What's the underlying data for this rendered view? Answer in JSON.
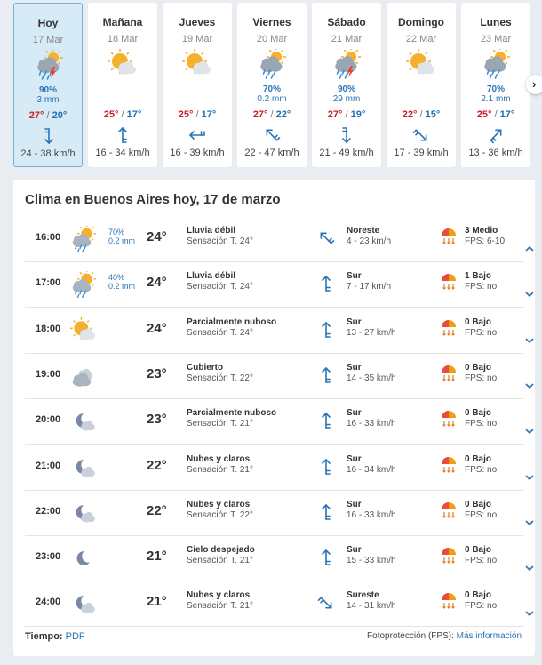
{
  "days": [
    {
      "name": "Hoy",
      "date": "17 Mar",
      "icon": "storm-rain-icon",
      "prob": "90%",
      "mm": "3 mm",
      "tmax": "27°",
      "tmin": "20°",
      "wind_icon": "wind-south-icon",
      "wind": "24 - 38 km/h",
      "active": true
    },
    {
      "name": "Mañana",
      "date": "18 Mar",
      "icon": "partly-cloudy-icon",
      "prob": "",
      "mm": "",
      "tmax": "25°",
      "tmin": "17°",
      "wind_icon": "wind-north-icon",
      "wind": "16 - 34 km/h",
      "active": false
    },
    {
      "name": "Jueves",
      "date": "19 Mar",
      "icon": "partly-cloudy-icon",
      "prob": "",
      "mm": "",
      "tmax": "25°",
      "tmin": "17°",
      "wind_icon": "wind-east-icon",
      "wind": "16 - 39 km/h",
      "active": false
    },
    {
      "name": "Viernes",
      "date": "20 Mar",
      "icon": "cloud-rain-icon",
      "prob": "70%",
      "mm": "0.2 mm",
      "tmax": "27°",
      "tmin": "22°",
      "wind_icon": "wind-northeast-icon",
      "wind": "22 - 47 km/h",
      "active": false
    },
    {
      "name": "Sábado",
      "date": "21 Mar",
      "icon": "storm-rain-icon",
      "prob": "90%",
      "mm": "29 mm",
      "tmax": "27°",
      "tmin": "19°",
      "wind_icon": "wind-south-icon",
      "wind": "21 - 49 km/h",
      "active": false
    },
    {
      "name": "Domingo",
      "date": "22 Mar",
      "icon": "partly-cloudy-icon",
      "prob": "",
      "mm": "",
      "tmax": "22°",
      "tmin": "15°",
      "wind_icon": "wind-northwest-icon",
      "wind": "17 - 39 km/h",
      "active": false
    },
    {
      "name": "Lunes",
      "date": "23 Mar",
      "icon": "cloud-rain-icon",
      "prob": "70%",
      "mm": "2.1 mm",
      "tmax": "25°",
      "tmin": "17°",
      "wind_icon": "wind-southwest-icon",
      "wind": "13 - 36 km/h",
      "active": false
    }
  ],
  "temp_sep": "/",
  "next_label": "›",
  "title": "Clima en Buenos Aires hoy, 17 de marzo",
  "hours": [
    {
      "hour": "16:00",
      "icon": "sun-cloud-rain-icon",
      "prob": "70%",
      "mm": "0.2 mm",
      "temp": "24°",
      "desc": "Lluvia débil",
      "feel": "Sensación T. 24°",
      "wind_icon": "wind-northeast-icon",
      "dir": "Noreste",
      "wind": "4 - 23 km/h",
      "uv": "3 Medio",
      "fps": "FPS: 6-10",
      "expanded": true
    },
    {
      "hour": "17:00",
      "icon": "sun-cloud-rain-icon",
      "prob": "40%",
      "mm": "0.2 mm",
      "temp": "24°",
      "desc": "Lluvia débil",
      "feel": "Sensación T. 24°",
      "wind_icon": "wind-north-icon",
      "dir": "Sur",
      "wind": "7 - 17 km/h",
      "uv": "1 Bajo",
      "fps": "FPS: no",
      "expanded": false
    },
    {
      "hour": "18:00",
      "icon": "partly-cloudy-icon",
      "prob": "",
      "mm": "",
      "temp": "24°",
      "desc": "Parcialmente nuboso",
      "feel": "Sensación T. 24°",
      "wind_icon": "wind-north-icon",
      "dir": "Sur",
      "wind": "13 - 27 km/h",
      "uv": "0 Bajo",
      "fps": "FPS: no",
      "expanded": false
    },
    {
      "hour": "19:00",
      "icon": "cloudy-icon",
      "prob": "",
      "mm": "",
      "temp": "23°",
      "desc": "Cubierto",
      "feel": "Sensación T. 22°",
      "wind_icon": "wind-north-icon",
      "dir": "Sur",
      "wind": "14 - 35 km/h",
      "uv": "0 Bajo",
      "fps": "FPS: no",
      "expanded": false
    },
    {
      "hour": "20:00",
      "icon": "moon-cloud-icon",
      "prob": "",
      "mm": "",
      "temp": "23°",
      "desc": "Parcialmente nuboso",
      "feel": "Sensación T. 21°",
      "wind_icon": "wind-north-icon",
      "dir": "Sur",
      "wind": "16 - 33 km/h",
      "uv": "0 Bajo",
      "fps": "FPS: no",
      "expanded": false
    },
    {
      "hour": "21:00",
      "icon": "moon-cloud-icon",
      "prob": "",
      "mm": "",
      "temp": "22°",
      "desc": "Nubes y claros",
      "feel": "Sensación T. 21°",
      "wind_icon": "wind-north-icon",
      "dir": "Sur",
      "wind": "16 - 34 km/h",
      "uv": "0 Bajo",
      "fps": "FPS: no",
      "expanded": false
    },
    {
      "hour": "22:00",
      "icon": "moon-cloud-icon",
      "prob": "",
      "mm": "",
      "temp": "22°",
      "desc": "Nubes y claros",
      "feel": "Sensación T. 22°",
      "wind_icon": "wind-north-icon",
      "dir": "Sur",
      "wind": "16 - 33 km/h",
      "uv": "0 Bajo",
      "fps": "FPS: no",
      "expanded": false
    },
    {
      "hour": "23:00",
      "icon": "moon-icon",
      "prob": "",
      "mm": "",
      "temp": "21°",
      "desc": "Cielo despejado",
      "feel": "Sensación T. 21°",
      "wind_icon": "wind-north-icon",
      "dir": "Sur",
      "wind": "15 - 33 km/h",
      "uv": "0 Bajo",
      "fps": "FPS: no",
      "expanded": false
    },
    {
      "hour": "24:00",
      "icon": "moon-cloud-icon",
      "prob": "",
      "mm": "",
      "temp": "21°",
      "desc": "Nubes y claros",
      "feel": "Sensación T. 21°",
      "wind_icon": "wind-northwest-icon",
      "dir": "Sureste",
      "wind": "14 - 31 km/h",
      "uv": "0 Bajo",
      "fps": "FPS: no",
      "expanded": false
    }
  ],
  "footer": {
    "tiempo_label": "Tiempo:",
    "pdf_link": "PDF",
    "fps_label": "Fotoprotección (FPS):",
    "more_link": "Más información"
  },
  "colors": {
    "accent": "#2a74b5",
    "temp_max": "#c8202a",
    "temp_min": "#1f6fb4",
    "active_day_bg": "#d7ebf7",
    "sun": "#f5b02e",
    "cloud": "#b9c3cd"
  }
}
